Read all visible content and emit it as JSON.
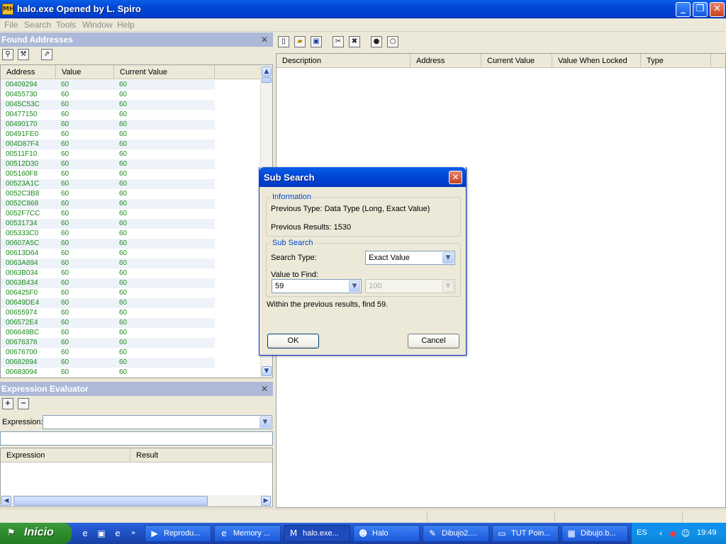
{
  "window": {
    "title": "halo.exe Opened by L. Spiro",
    "app_icon": "mhs-icon",
    "app_icon_text": "MH",
    "controls": {
      "minimize": "_",
      "restore": "❐",
      "close": "✕"
    }
  },
  "menu": [
    "File",
    "Search",
    "Tools",
    "Window",
    "Help"
  ],
  "found_addresses": {
    "title": "Found Addresses",
    "toolbar_icons": [
      "search-icon",
      "tools-icon",
      "export-icon"
    ],
    "columns": [
      "Address",
      "Value",
      "Current Value"
    ],
    "rows": [
      [
        "00409294",
        "60",
        "60"
      ],
      [
        "00455730",
        "60",
        "60"
      ],
      [
        "0045C53C",
        "60",
        "60"
      ],
      [
        "00477150",
        "60",
        "60"
      ],
      [
        "00490170",
        "60",
        "60"
      ],
      [
        "00491FE0",
        "60",
        "60"
      ],
      [
        "004D87F4",
        "60",
        "60"
      ],
      [
        "00511F10",
        "60",
        "60"
      ],
      [
        "00512D30",
        "60",
        "60"
      ],
      [
        "005160F8",
        "60",
        "60"
      ],
      [
        "00523A1C",
        "60",
        "60"
      ],
      [
        "0052C3B8",
        "60",
        "60"
      ],
      [
        "0052C868",
        "60",
        "60"
      ],
      [
        "0052F7CC",
        "60",
        "60"
      ],
      [
        "00531734",
        "60",
        "60"
      ],
      [
        "005333C0",
        "60",
        "60"
      ],
      [
        "00607A5C",
        "60",
        "60"
      ],
      [
        "00613D64",
        "60",
        "60"
      ],
      [
        "0063A894",
        "60",
        "60"
      ],
      [
        "0063B034",
        "60",
        "60"
      ],
      [
        "0063B434",
        "60",
        "60"
      ],
      [
        "006425F0",
        "60",
        "60"
      ],
      [
        "00649DE4",
        "60",
        "60"
      ],
      [
        "00655974",
        "60",
        "60"
      ],
      [
        "006572E4",
        "60",
        "60"
      ],
      [
        "006649BC",
        "60",
        "60"
      ],
      [
        "00676378",
        "60",
        "60"
      ],
      [
        "00676700",
        "60",
        "60"
      ],
      [
        "00682894",
        "60",
        "60"
      ],
      [
        "00683094",
        "60",
        "60"
      ]
    ]
  },
  "expression_evaluator": {
    "title": "Expression Evaluator",
    "expression_label": "Expression:",
    "expression_value": "",
    "columns": [
      "Expression",
      "Result"
    ]
  },
  "main_list": {
    "toolbar_icons": [
      "new-icon",
      "open-icon",
      "save-icon",
      "cut-icon",
      "delete-icon",
      "lock-icon",
      "unlock-icon"
    ],
    "columns": [
      "Description",
      "Address",
      "Current Value",
      "Value When Locked",
      "Type"
    ]
  },
  "dialog": {
    "title": "Sub Search",
    "info_legend": "Information",
    "previous_type": "Previous Type: Data Type (Long, Exact Value)",
    "previous_results": "Previous Results: 1530",
    "sub_legend": "Sub Search",
    "search_type_label": "Search Type:",
    "search_type_value": "Exact Value",
    "value_label": "Value to Find:",
    "value": "59",
    "value2": "100",
    "description": "Within the previous results, find 59.",
    "ok": "OK",
    "cancel": "Cancel"
  },
  "taskbar": {
    "start": "Inicio",
    "tasks": [
      {
        "label": "Reprodu...",
        "icon": "media-player-icon",
        "glyph": "▶"
      },
      {
        "label": "Memory ...",
        "icon": "ie-icon",
        "glyph": "e"
      },
      {
        "label": "halo.exe...",
        "icon": "mhs-icon",
        "glyph": "M"
      },
      {
        "label": "Halo",
        "icon": "halo-icon",
        "glyph": "☻"
      },
      {
        "label": "Dibujo2....",
        "icon": "paint-icon",
        "glyph": "✎"
      },
      {
        "label": "TUT Poin...",
        "icon": "folder-icon",
        "glyph": "▭"
      },
      {
        "label": "Dibujo.b...",
        "icon": "image-icon",
        "glyph": "▦"
      }
    ],
    "language": "ES",
    "clock": "19:49"
  }
}
